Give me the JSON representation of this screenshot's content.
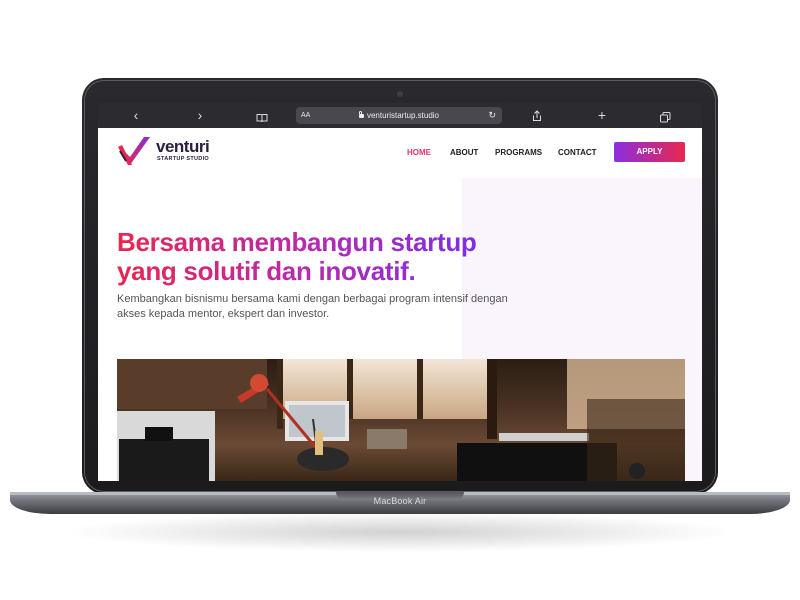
{
  "device": {
    "model_label": "MacBook Air"
  },
  "browser": {
    "back_icon": "chevron-left-icon",
    "forward_icon": "chevron-right-icon",
    "text_size_label": "AA",
    "url": "venturistartup.studio",
    "reload_icon": "reload-icon",
    "share_icon": "share-icon",
    "new_tab_icon": "plus-icon",
    "tabs_icon": "tabs-icon"
  },
  "site": {
    "logo": {
      "name": "venturi",
      "tagline": "STARTUP STUDIO"
    },
    "nav": [
      {
        "label": "HOME",
        "active": true
      },
      {
        "label": "ABOUT",
        "active": false
      },
      {
        "label": "PROGRAMS",
        "active": false
      },
      {
        "label": "CONTACT",
        "active": false
      }
    ],
    "apply_label": "APPLY",
    "hero_line1": "Bersama membangun startup",
    "hero_line2": "yang solutif dan inovatif.",
    "subtitle": "Kembangkan bisnismu bersama kami dengan berbagai program intensif dengan akses kepada mentor, ekspert dan investor.",
    "colors": {
      "accent_pink": "#e8274f",
      "accent_purple": "#7c2ee6",
      "panel_tint": "#faf4fc"
    }
  }
}
